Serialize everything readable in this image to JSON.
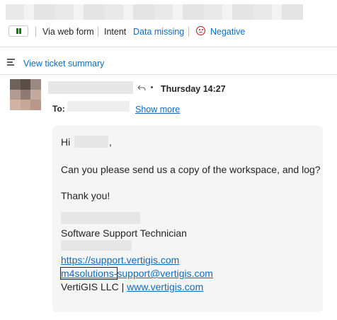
{
  "header": {
    "status": {
      "channel": "Via web form",
      "intent_label": "Intent",
      "intent_value": "Data missing",
      "sentiment": "Negative"
    },
    "summary_link": "View ticket summary"
  },
  "email": {
    "time": "Thursday 14:27",
    "to_label": "To:",
    "show_more": "Show more",
    "body": {
      "greeting_prefix": "Hi",
      "greeting_suffix": ",",
      "question": "Can you please send us a copy of the workspace, and log?",
      "thanks": "Thank you!",
      "signature_title": "Software Support Technician",
      "support_url": "https://support.vertigis.com",
      "email_part1": "m4solutions-",
      "email_part2": "support@vertigis.com",
      "company": "VertiGIS LLC | ",
      "company_url": "www.vertigis.com"
    }
  },
  "colors": {
    "link": "#0f6cbd",
    "positive_green": "#107c10",
    "negative_red": "#c50f1f",
    "card_bg": "#f5f5f5"
  },
  "icons": [
    "pause-icon",
    "negative-sentiment-icon",
    "summary-list-icon",
    "reply-icon"
  ]
}
